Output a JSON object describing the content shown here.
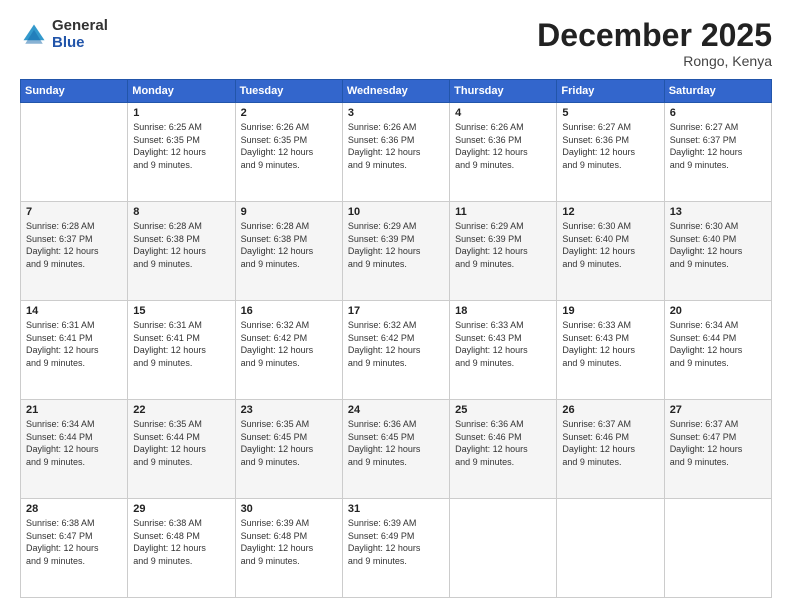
{
  "logo": {
    "general": "General",
    "blue": "Blue"
  },
  "header": {
    "title": "December 2025",
    "subtitle": "Rongo, Kenya"
  },
  "weekdays": [
    "Sunday",
    "Monday",
    "Tuesday",
    "Wednesday",
    "Thursday",
    "Friday",
    "Saturday"
  ],
  "weeks": [
    {
      "shaded": false,
      "days": [
        {
          "num": "",
          "info": ""
        },
        {
          "num": "1",
          "info": "Sunrise: 6:25 AM\nSunset: 6:35 PM\nDaylight: 12 hours\nand 9 minutes."
        },
        {
          "num": "2",
          "info": "Sunrise: 6:26 AM\nSunset: 6:35 PM\nDaylight: 12 hours\nand 9 minutes."
        },
        {
          "num": "3",
          "info": "Sunrise: 6:26 AM\nSunset: 6:36 PM\nDaylight: 12 hours\nand 9 minutes."
        },
        {
          "num": "4",
          "info": "Sunrise: 6:26 AM\nSunset: 6:36 PM\nDaylight: 12 hours\nand 9 minutes."
        },
        {
          "num": "5",
          "info": "Sunrise: 6:27 AM\nSunset: 6:36 PM\nDaylight: 12 hours\nand 9 minutes."
        },
        {
          "num": "6",
          "info": "Sunrise: 6:27 AM\nSunset: 6:37 PM\nDaylight: 12 hours\nand 9 minutes."
        }
      ]
    },
    {
      "shaded": true,
      "days": [
        {
          "num": "7",
          "info": "Sunrise: 6:28 AM\nSunset: 6:37 PM\nDaylight: 12 hours\nand 9 minutes."
        },
        {
          "num": "8",
          "info": "Sunrise: 6:28 AM\nSunset: 6:38 PM\nDaylight: 12 hours\nand 9 minutes."
        },
        {
          "num": "9",
          "info": "Sunrise: 6:28 AM\nSunset: 6:38 PM\nDaylight: 12 hours\nand 9 minutes."
        },
        {
          "num": "10",
          "info": "Sunrise: 6:29 AM\nSunset: 6:39 PM\nDaylight: 12 hours\nand 9 minutes."
        },
        {
          "num": "11",
          "info": "Sunrise: 6:29 AM\nSunset: 6:39 PM\nDaylight: 12 hours\nand 9 minutes."
        },
        {
          "num": "12",
          "info": "Sunrise: 6:30 AM\nSunset: 6:40 PM\nDaylight: 12 hours\nand 9 minutes."
        },
        {
          "num": "13",
          "info": "Sunrise: 6:30 AM\nSunset: 6:40 PM\nDaylight: 12 hours\nand 9 minutes."
        }
      ]
    },
    {
      "shaded": false,
      "days": [
        {
          "num": "14",
          "info": "Sunrise: 6:31 AM\nSunset: 6:41 PM\nDaylight: 12 hours\nand 9 minutes."
        },
        {
          "num": "15",
          "info": "Sunrise: 6:31 AM\nSunset: 6:41 PM\nDaylight: 12 hours\nand 9 minutes."
        },
        {
          "num": "16",
          "info": "Sunrise: 6:32 AM\nSunset: 6:42 PM\nDaylight: 12 hours\nand 9 minutes."
        },
        {
          "num": "17",
          "info": "Sunrise: 6:32 AM\nSunset: 6:42 PM\nDaylight: 12 hours\nand 9 minutes."
        },
        {
          "num": "18",
          "info": "Sunrise: 6:33 AM\nSunset: 6:43 PM\nDaylight: 12 hours\nand 9 minutes."
        },
        {
          "num": "19",
          "info": "Sunrise: 6:33 AM\nSunset: 6:43 PM\nDaylight: 12 hours\nand 9 minutes."
        },
        {
          "num": "20",
          "info": "Sunrise: 6:34 AM\nSunset: 6:44 PM\nDaylight: 12 hours\nand 9 minutes."
        }
      ]
    },
    {
      "shaded": true,
      "days": [
        {
          "num": "21",
          "info": "Sunrise: 6:34 AM\nSunset: 6:44 PM\nDaylight: 12 hours\nand 9 minutes."
        },
        {
          "num": "22",
          "info": "Sunrise: 6:35 AM\nSunset: 6:44 PM\nDaylight: 12 hours\nand 9 minutes."
        },
        {
          "num": "23",
          "info": "Sunrise: 6:35 AM\nSunset: 6:45 PM\nDaylight: 12 hours\nand 9 minutes."
        },
        {
          "num": "24",
          "info": "Sunrise: 6:36 AM\nSunset: 6:45 PM\nDaylight: 12 hours\nand 9 minutes."
        },
        {
          "num": "25",
          "info": "Sunrise: 6:36 AM\nSunset: 6:46 PM\nDaylight: 12 hours\nand 9 minutes."
        },
        {
          "num": "26",
          "info": "Sunrise: 6:37 AM\nSunset: 6:46 PM\nDaylight: 12 hours\nand 9 minutes."
        },
        {
          "num": "27",
          "info": "Sunrise: 6:37 AM\nSunset: 6:47 PM\nDaylight: 12 hours\nand 9 minutes."
        }
      ]
    },
    {
      "shaded": false,
      "days": [
        {
          "num": "28",
          "info": "Sunrise: 6:38 AM\nSunset: 6:47 PM\nDaylight: 12 hours\nand 9 minutes."
        },
        {
          "num": "29",
          "info": "Sunrise: 6:38 AM\nSunset: 6:48 PM\nDaylight: 12 hours\nand 9 minutes."
        },
        {
          "num": "30",
          "info": "Sunrise: 6:39 AM\nSunset: 6:48 PM\nDaylight: 12 hours\nand 9 minutes."
        },
        {
          "num": "31",
          "info": "Sunrise: 6:39 AM\nSunset: 6:49 PM\nDaylight: 12 hours\nand 9 minutes."
        },
        {
          "num": "",
          "info": ""
        },
        {
          "num": "",
          "info": ""
        },
        {
          "num": "",
          "info": ""
        }
      ]
    }
  ]
}
